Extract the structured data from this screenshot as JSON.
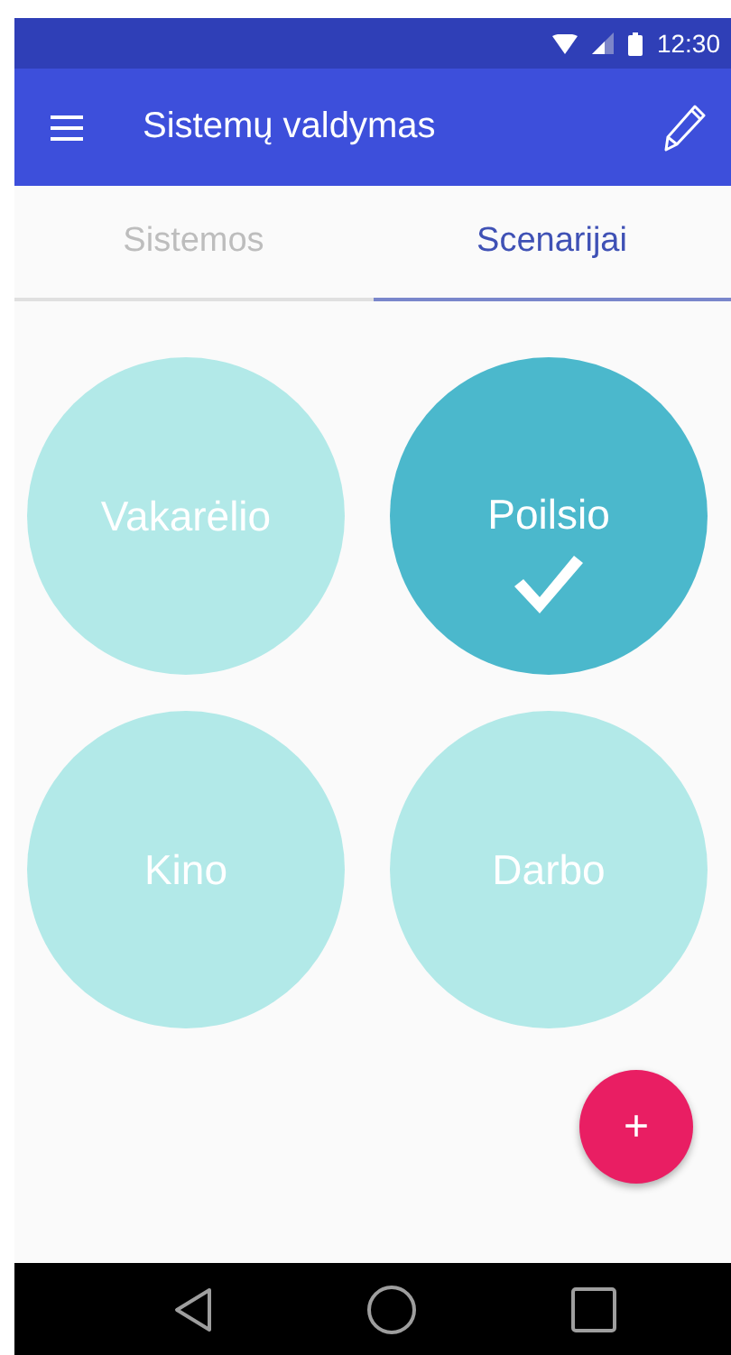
{
  "status_bar": {
    "time": "12:30"
  },
  "app_bar": {
    "title": "Sistemų valdymas"
  },
  "tabs": [
    {
      "label": "Sistemos",
      "selected": false
    },
    {
      "label": "Scenarijai",
      "selected": true
    }
  ],
  "scenarios": [
    {
      "label": "Vakarėlio",
      "selected": false
    },
    {
      "label": "Poilsio",
      "selected": true
    },
    {
      "label": "Kino",
      "selected": false
    },
    {
      "label": "Darbo",
      "selected": false
    }
  ],
  "fab": {
    "label": "+"
  }
}
